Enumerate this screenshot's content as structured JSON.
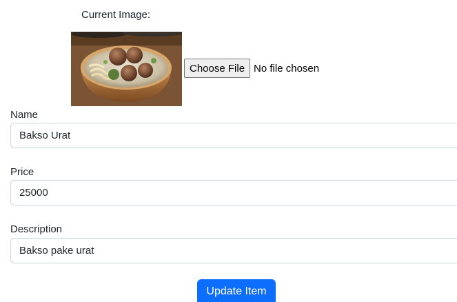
{
  "current_image": {
    "label": "Current Image:",
    "alt": "Bakso Urat"
  },
  "file_input": {
    "button_label": "Choose File",
    "status_text": "No file chosen"
  },
  "fields": {
    "name": {
      "label": "Name",
      "value": "Bakso Urat"
    },
    "price": {
      "label": "Price",
      "value": "25000"
    },
    "description": {
      "label": "Description",
      "value": "Bakso pake urat"
    }
  },
  "submit": {
    "label": "Update Item"
  },
  "colors": {
    "primary": "#0d6efd",
    "input_border": "#ced4da",
    "text": "#212529"
  }
}
